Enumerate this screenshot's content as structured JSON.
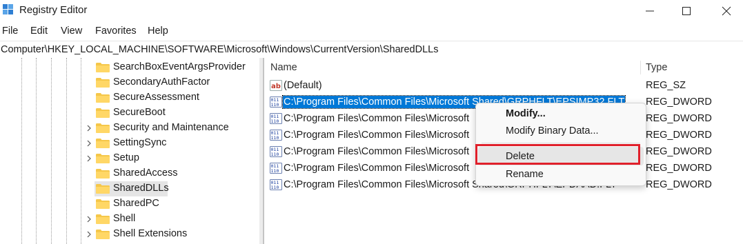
{
  "window": {
    "title": "Registry Editor"
  },
  "menu": [
    "File",
    "Edit",
    "View",
    "Favorites",
    "Help"
  ],
  "address": "Computer\\HKEY_LOCAL_MACHINE\\SOFTWARE\\Microsoft\\Windows\\CurrentVersion\\SharedDLLs",
  "tree": [
    {
      "label": "SearchBoxEventArgsProvider",
      "expandable": false
    },
    {
      "label": "SecondaryAuthFactor",
      "expandable": false
    },
    {
      "label": "SecureAssessment",
      "expandable": false
    },
    {
      "label": "SecureBoot",
      "expandable": false
    },
    {
      "label": "Security and Maintenance",
      "expandable": true
    },
    {
      "label": "SettingSync",
      "expandable": true
    },
    {
      "label": "Setup",
      "expandable": true
    },
    {
      "label": "SharedAccess",
      "expandable": false
    },
    {
      "label": "SharedDLLs",
      "expandable": false,
      "selected": true
    },
    {
      "label": "SharedPC",
      "expandable": false
    },
    {
      "label": "Shell",
      "expandable": true
    },
    {
      "label": "Shell Extensions",
      "expandable": true
    }
  ],
  "columns": {
    "name": "Name",
    "type": "Type"
  },
  "values": [
    {
      "name": "(Default)",
      "type": "REG_SZ",
      "icon": "string-value-icon"
    },
    {
      "name": "C:\\Program Files\\Common Files\\Microsoft Shared\\GRPHFLT\\EPSIMP32.FLT",
      "type": "REG_DWORD",
      "icon": "binary-value-icon",
      "selected": true
    },
    {
      "name": "C:\\Program Files\\Common Files\\Microsoft",
      "type": "REG_DWORD",
      "icon": "binary-value-icon"
    },
    {
      "name": "C:\\Program Files\\Common Files\\Microsoft",
      "type": "REG_DWORD",
      "icon": "binary-value-icon"
    },
    {
      "name": "C:\\Program Files\\Common Files\\Microsoft",
      "type": "REG_DWORD",
      "icon": "binary-value-icon"
    },
    {
      "name": "C:\\Program Files\\Common Files\\Microsoft",
      "type": "REG_DWORD",
      "icon": "binary-value-icon"
    },
    {
      "name": "C:\\Program Files\\Common Files\\Microsoft Shared\\GRPHFLT\\EPDAAD.FLT",
      "type": "REG_DWORD",
      "icon": "binary-value-icon"
    }
  ],
  "context_menu": {
    "items": [
      "Modify...",
      "Modify Binary Data...",
      "Delete",
      "Rename"
    ],
    "highlighted": "Delete"
  },
  "colors": {
    "accent": "#0078d7",
    "highlight": "#e0202b",
    "folder": "#f5c74a"
  }
}
